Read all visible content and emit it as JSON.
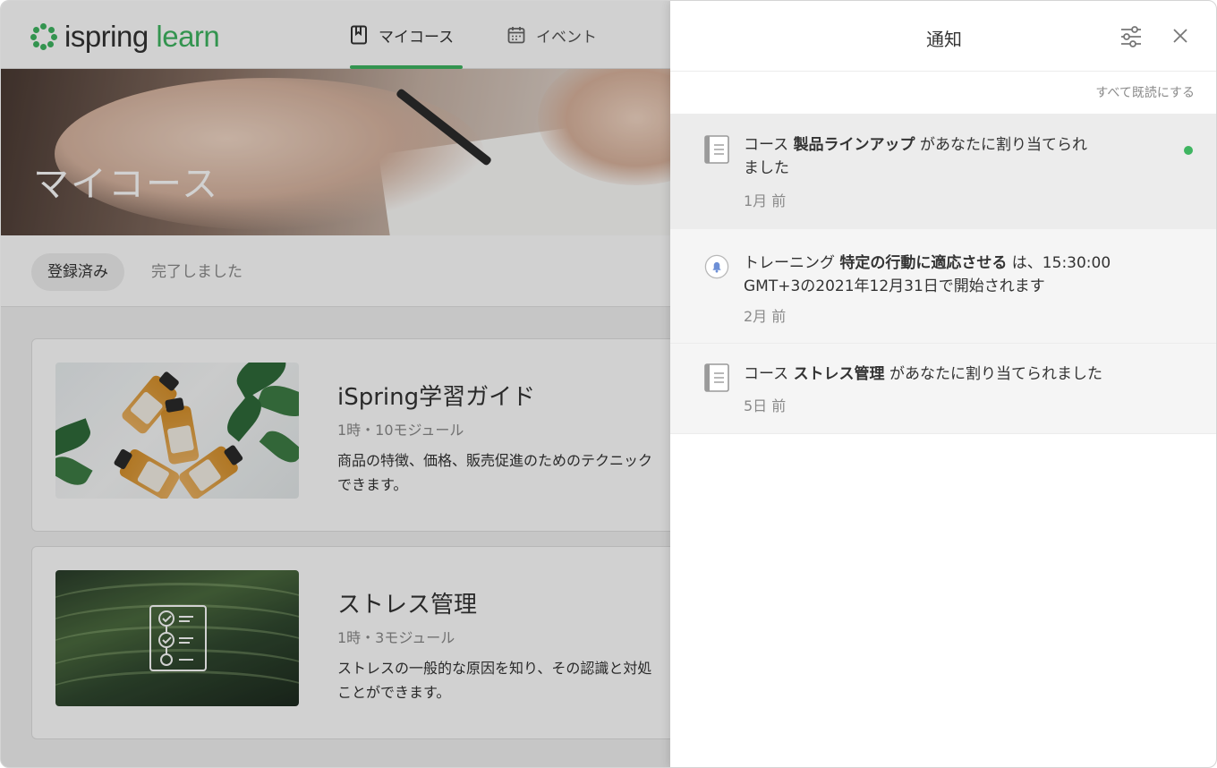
{
  "brand": {
    "name_main": "ispring",
    "name_accent": "learn",
    "accent_color": "#3fb561"
  },
  "nav": {
    "tabs": [
      {
        "label": "マイコース",
        "icon": "book-icon",
        "active": true
      },
      {
        "label": "イベント",
        "icon": "calendar-icon",
        "active": false
      }
    ]
  },
  "hero": {
    "title": "マイコース"
  },
  "filters": {
    "items": [
      {
        "label": "登録済み",
        "active": true
      },
      {
        "label": "完了しました",
        "active": false
      }
    ]
  },
  "courses": [
    {
      "title": "iSpring学習ガイド",
      "meta": "1時・10モジュール",
      "description": "商品の特徴、価格、販売促進のためのテクニック",
      "description2": "できます。"
    },
    {
      "title": "ストレス管理",
      "meta": "1時・3モジュール",
      "description": "ストレスの一般的な原因を知り、その認識と対処",
      "description2": "ことができます。"
    }
  ],
  "panel": {
    "title": "通知",
    "mark_all_read": "すべて既読にする",
    "notifications": [
      {
        "icon": "document-icon",
        "prefix": "コース ",
        "bold": "製品ラインアップ",
        "suffix": " があなたに割り当てられ",
        "line2": "ました",
        "time": "1月 前",
        "unread": true
      },
      {
        "icon": "bell-icon",
        "prefix": "トレーニング ",
        "bold": "特定の行動に適応させる",
        "suffix": " は、15:30:00",
        "line2": "GMT+3の2021年12月31日で開始されます",
        "time": "2月 前",
        "unread": false
      },
      {
        "icon": "document-icon",
        "prefix": "コース ",
        "bold": "ストレス管理",
        "suffix": " があなたに割り当てられました",
        "line2": "",
        "time": "5日 前",
        "unread": false
      }
    ]
  }
}
